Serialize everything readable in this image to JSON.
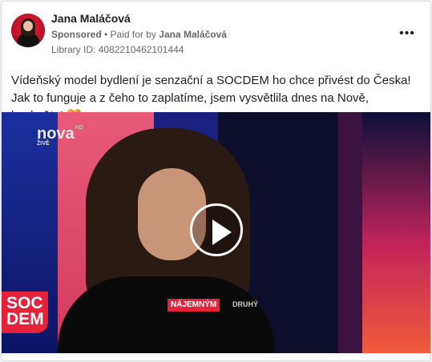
{
  "post": {
    "author": "Jana Maláčová",
    "sponsored_label": "Sponsored",
    "paid_for_prefix": "• Paid for by",
    "paid_for_name": "Jana Maláčová",
    "library_id": "Library ID: 4082210462101444",
    "more_icon": "•••",
    "caption": "Vídeňský model bydlení je senzační a SOCDEM ho chce přivést do Česka! Jak to funguje a z čeho to zaplatíme, jsem vysvětlila dnes na Nově, koukněte!",
    "caption_emoji": "🧡"
  },
  "video": {
    "channel_logo": "nova",
    "channel_sup": "HD",
    "channel_live": "ŽIVĚ",
    "party_badge_line1": "SOC",
    "party_badge_line2": "DEM",
    "lower_third_tag": "NÁJEMNÝM",
    "lower_third_next": "DRUHÝ"
  },
  "colors": {
    "accent_red": "#e6223a",
    "text_primary": "#1c1e21",
    "text_secondary": "#65676b"
  }
}
